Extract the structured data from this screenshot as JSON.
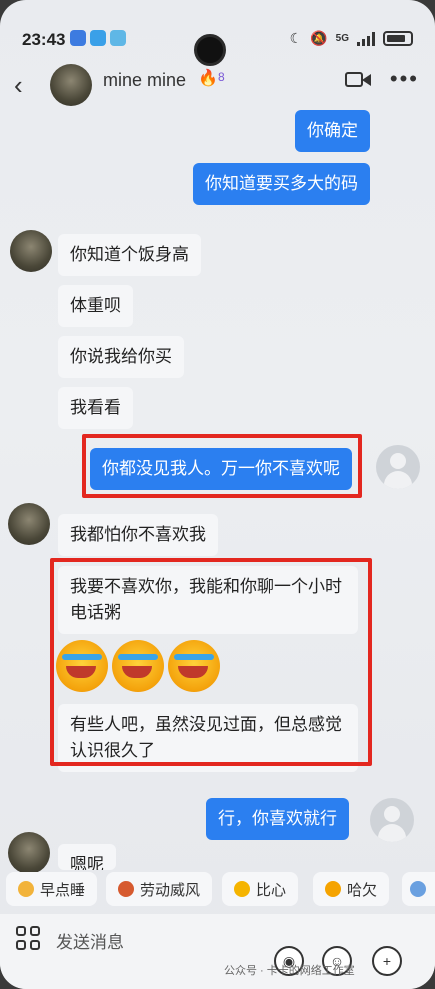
{
  "status_bar": {
    "time": "23:43",
    "network": "5G"
  },
  "header": {
    "contact_name": "mine  mine",
    "level": "8"
  },
  "messages": [
    {
      "text": "你确定",
      "from": "me"
    },
    {
      "text": "你知道要买多大的码",
      "from": "me"
    },
    {
      "text": "你知道个饭身高",
      "from": "them"
    },
    {
      "text": "体重呗",
      "from": "them"
    },
    {
      "text": "你说我给你买",
      "from": "them"
    },
    {
      "text": "我看看",
      "from": "them"
    },
    {
      "text": "你都没见我人。万一你不喜欢呢",
      "from": "me"
    },
    {
      "text": "我都怕你不喜欢我",
      "from": "them"
    },
    {
      "text": "我要不喜欢你，我能和你聊一个小时电话粥",
      "from": "them"
    },
    {
      "text": "有些人吧，虽然没见过面，但总感觉认识很久了",
      "from": "them"
    },
    {
      "text": "行，你喜欢就行",
      "from": "me"
    },
    {
      "text": "嗯呢",
      "from": "them"
    }
  ],
  "quick_replies": [
    "早点睡",
    "劳动威风",
    "比心",
    "哈欠"
  ],
  "input": {
    "placeholder": "发送消息"
  },
  "watermark": "公众号 · 卡卡的网络工作室"
}
